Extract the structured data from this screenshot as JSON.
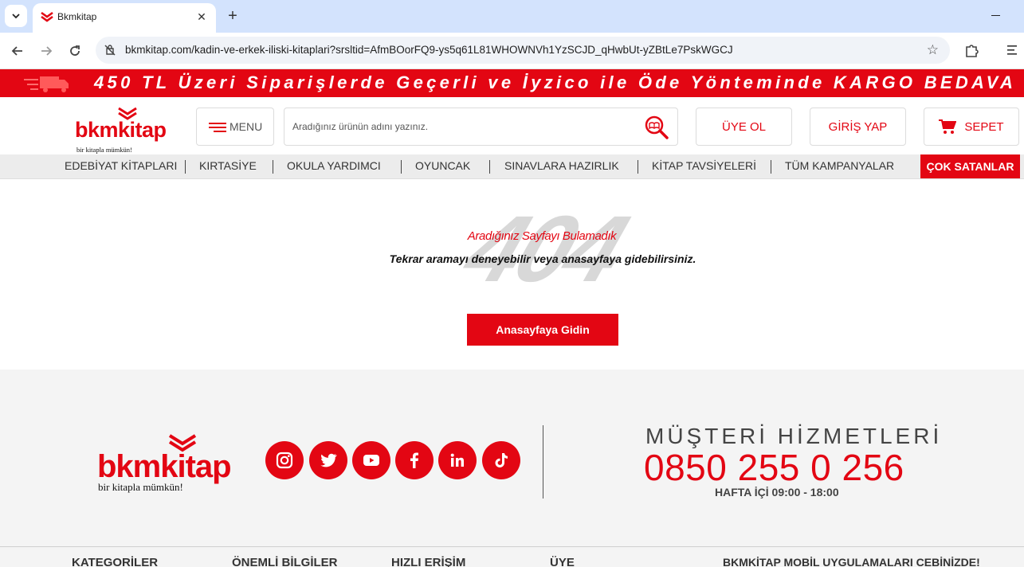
{
  "browser": {
    "tab_title": "Bkmkitap",
    "url": "bkmkitap.com/kadin-ve-erkek-iliski-kitaplari?srsltid=AfmBOorFQ9-ys5q61L81WHOWNVh1YzSCJD_qHwbUt-yZBtLe7PskWGCJ"
  },
  "promo": {
    "text": "450 TL Üzeri Siparişlerde Geçerli ve İyzico ile Öde Yönteminde KARGO BEDAVA"
  },
  "header": {
    "logo_text": "bkmkitap",
    "logo_tagline": "bir kitapla mümkün!",
    "menu_label": "MENU",
    "search_placeholder": "Aradığınız ürünün adını yazınız.",
    "register_label": "ÜYE OL",
    "login_label": "GİRİŞ YAP",
    "cart_label": "SEPET"
  },
  "categories": [
    "EDEBİYAT KİTAPLARI",
    "KIRTASİYE",
    "OKULA YARDIMCI",
    "OYUNCAK",
    "SINAVLARA HAZIRLIK",
    "KİTAP TAVSİYELERİ",
    "TÜM KAMPANYALAR"
  ],
  "category_highlight": "ÇOK SATANLAR",
  "error": {
    "code": "404",
    "title": "Aradığınız Sayfayı Bulamadık",
    "subtitle": "Tekrar aramayı deneyebilir veya anasayfaya gidebilirsiniz.",
    "home_button": "Anasayfaya Gidin"
  },
  "footer": {
    "logo_text": "bkmkitap",
    "logo_tagline": "bir kitapla mümkün!",
    "social": [
      "instagram-icon",
      "twitter-icon",
      "youtube-icon",
      "facebook-icon",
      "linkedin-icon",
      "tiktok-icon"
    ],
    "customer_service_title": "MÜŞTERİ HİZMETLERİ",
    "phone": "0850 255 0 256",
    "hours": "HAFTA İÇİ 09:00 - 18:00",
    "columns": [
      "KATEGORİLER",
      "ÖNEMLİ BİLGİLER",
      "HIZLI ERİŞİM",
      "ÜYE",
      "BKMKİTAP MOBİL UYGULAMALARI CEBİNİZDE!"
    ]
  },
  "colors": {
    "brand": "#e30613",
    "tabstrip": "#d3e3fd"
  }
}
